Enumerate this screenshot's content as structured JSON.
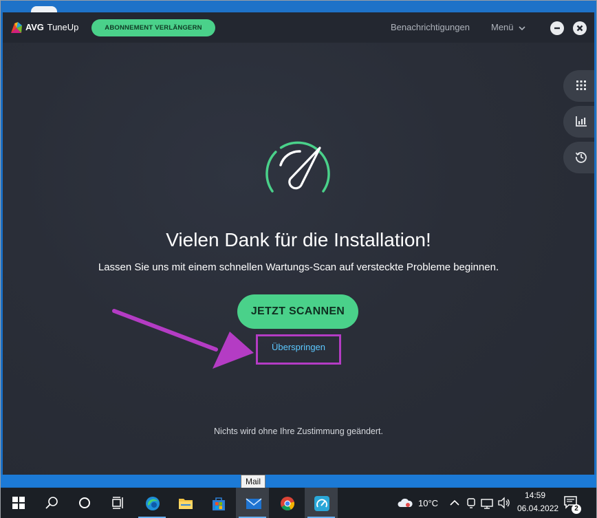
{
  "app": {
    "brand_primary": "AVG",
    "brand_secondary": "TuneUp",
    "renew_button": "ABONNEMENT VERLÄNGERN",
    "notifications_link": "Benachrichtigungen",
    "menu_label": "Menü"
  },
  "side_tabs": [
    {
      "icon": "apps-grid-icon"
    },
    {
      "icon": "bar-chart-icon"
    },
    {
      "icon": "history-icon"
    }
  ],
  "main": {
    "headline": "Vielen Dank für die Installation!",
    "subline": "Lassen Sie uns mit einem schnellen Wartungs-Scan auf versteckte Probleme beginnen.",
    "scan_button": "JETZT SCANNEN",
    "skip_link": "Überspringen",
    "footnote": "Nichts wird ohne Ihre Zustimmung geändert."
  },
  "taskbar": {
    "tooltip": "Mail",
    "temperature": "10°C",
    "time": "14:59",
    "date": "06.04.2022",
    "notification_count": "2"
  },
  "colors": {
    "accent_green": "#4ad18a",
    "link_blue": "#5cc8ff",
    "annotation_purple": "#b43cc4",
    "app_background": "#2a2f3a"
  }
}
